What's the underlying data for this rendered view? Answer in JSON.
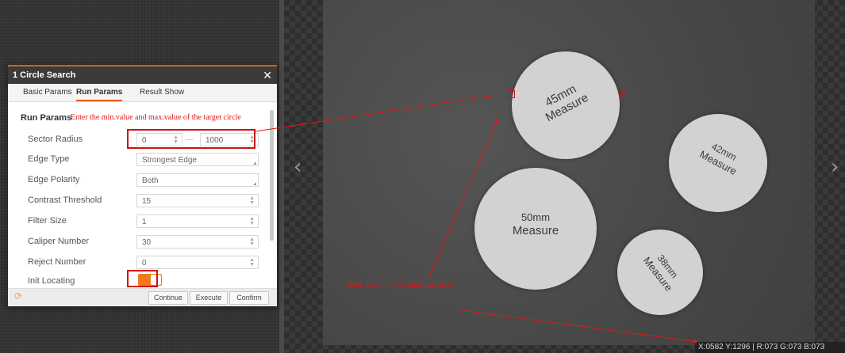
{
  "dialog": {
    "title": "1 Circle Search",
    "close_glyph": "✕",
    "tabs": [
      "Basic Params",
      "Run Params",
      "Result Show"
    ],
    "active_tab": "Run Params",
    "section_title": "Run Params",
    "params": [
      {
        "label": "Sector Radius",
        "min": "0",
        "max": "1000"
      },
      {
        "label": "Edge Type",
        "value": "Strongest Edge"
      },
      {
        "label": "Edge Polarity",
        "value": "Both"
      },
      {
        "label": "Contrast Threshold",
        "value": "15"
      },
      {
        "label": "Filter Size",
        "value": "1"
      },
      {
        "label": "Caliper Number",
        "value": "30"
      },
      {
        "label": "Reject Number",
        "value": "0"
      },
      {
        "label": "Init Locating",
        "toggle": "on"
      }
    ],
    "buttons": {
      "continue": "Continue",
      "execute": "Execute",
      "confirm": "Confirm"
    },
    "range_separator": "—"
  },
  "annotations": {
    "radius_hint": "Enter the min.value and max.value of the target circle",
    "x_hint": "Note down the X coordinate here"
  },
  "coins": [
    {
      "size": "45mm",
      "word": "Measure"
    },
    {
      "size": "42mm",
      "word": "Measure"
    },
    {
      "size": "50mm",
      "word": "Measure"
    },
    {
      "size": "38mm",
      "word": "Measure"
    }
  ],
  "status_bar": "X:0582  Y:1296  |  R:073  G:073  B:073",
  "viewer": {
    "prev_glyph": "‹",
    "next_glyph": "›"
  },
  "colors": {
    "accent": "#e25a1c",
    "annotation": "#e01818",
    "toggle_on": "#f07a1e"
  },
  "icons": [
    "close-icon",
    "refresh-icon",
    "chevron-left-icon",
    "chevron-right-icon"
  ]
}
